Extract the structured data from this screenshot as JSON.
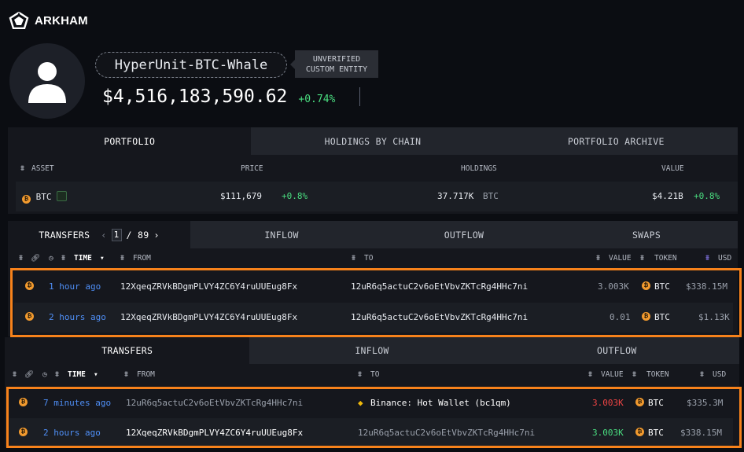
{
  "brand": {
    "name": "ARKHAM"
  },
  "entity": {
    "name": "HyperUnit-BTC-Whale",
    "badge_line1": "UNVERIFIED",
    "badge_line2": "CUSTOM ENTITY",
    "total_value": "$4,516,183,590.62",
    "change": "+0.74%"
  },
  "portfolio": {
    "tabs": [
      "PORTFOLIO",
      "HOLDINGS BY CHAIN",
      "PORTFOLIO ARCHIVE"
    ],
    "columns": {
      "asset": "ASSET",
      "price": "PRICE",
      "holdings": "HOLDINGS",
      "value": "VALUE"
    },
    "row": {
      "asset": "BTC",
      "price": "$111,679",
      "price_change": "+0.8%",
      "holdings": "37.717K",
      "holdings_unit": "BTC",
      "value": "$4.21B",
      "value_change": "+0.8%"
    }
  },
  "transfers_top": {
    "tabs": [
      "TRANSFERS",
      "INFLOW",
      "OUTFLOW",
      "SWAPS"
    ],
    "pager": {
      "current": "1",
      "total": "/ 89"
    },
    "columns": {
      "time": "TIME",
      "from": "FROM",
      "to": "TO",
      "value": "VALUE",
      "token": "TOKEN",
      "usd": "USD"
    },
    "rows": [
      {
        "time": "1 hour ago",
        "from": "12XqeqZRVkBDgmPLVY4ZC6Y4ruUUEug8Fx",
        "to": "12uR6q5actuC2v6oEtVbvZKTcRg4HHc7ni",
        "value": "3.003K",
        "token": "BTC",
        "usd": "$338.15M"
      },
      {
        "time": "2 hours ago",
        "from": "12XqeqZRVkBDgmPLVY4ZC6Y4ruUUEug8Fx",
        "to": "12uR6q5actuC2v6oEtVbvZKTcRg4HHc7ni",
        "value": "0.01",
        "token": "BTC",
        "usd": "$1.13K"
      }
    ]
  },
  "transfers_bottom": {
    "tabs": [
      "TRANSFERS",
      "INFLOW",
      "OUTFLOW"
    ],
    "columns": {
      "time": "TIME",
      "from": "FROM",
      "to": "TO",
      "value": "VALUE",
      "token": "TOKEN",
      "usd": "USD"
    },
    "rows": [
      {
        "time": "7 minutes ago",
        "from": "12uR6q5actuC2v6oEtVbvZKTcRg4HHc7ni",
        "to": "Binance: Hot Wallet (bc1qm)",
        "value": "3.003K",
        "token": "BTC",
        "usd": "$335.3M"
      },
      {
        "time": "2 hours ago",
        "from": "12XqeqZRVkBDgmPLVY4ZC6Y4ruUUEug8Fx",
        "to": "12uR6q5actuC2v6oEtVbvZKTcRg4HHc7ni",
        "value": "3.003K",
        "token": "BTC",
        "usd": "$338.15M"
      }
    ]
  },
  "colors": {
    "accent_blue": "#4f8ff7",
    "positive": "#4ade80",
    "negative": "#ef4444",
    "highlight": "#f7821b",
    "btc": "#f29a2e"
  }
}
